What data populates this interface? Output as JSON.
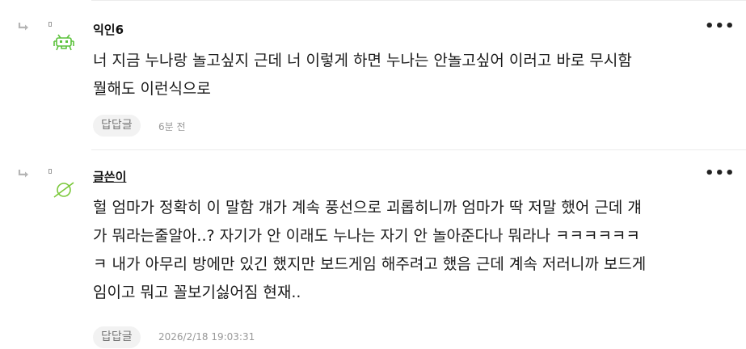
{
  "comments": [
    {
      "author": "익인6",
      "avatar_icon": "space-invader-icon",
      "avatar_color": "#5cc23c",
      "more_label": "•••",
      "text": "너 지금 누나랑 놀고싶지 근데 너 이렇게 하면 누나는 안놀고싶어 이러고 바로 무시함\n뭘해도 이런식으로",
      "reply_label": "답답글",
      "time": "6분 전"
    },
    {
      "author": "글쓴이",
      "avatar_icon": "planet-icon",
      "avatar_color": "#7ac83a",
      "more_label": "•••",
      "text": "헐 엄마가 정확히 이 말함 걔가 계속 풍선으로 괴롭히니까 엄마가 딱 저말 했어 근데 걔\n가 뭐라는줄알아..? 자기가 안 이래도 누나는 자기 안 놀아준다나 뭐라나 ㅋㅋㅋㅋㅋㅋ\nㅋ 내가 아무리 방에만 있긴 했지만 보드게임 해주려고 했음 근데 계속 저러니까 보드게\n임이고 뭐고 꼴보기싫어짐 현재..",
      "reply_label": "답답글",
      "time": "2026/2/18 19:03:31"
    }
  ]
}
